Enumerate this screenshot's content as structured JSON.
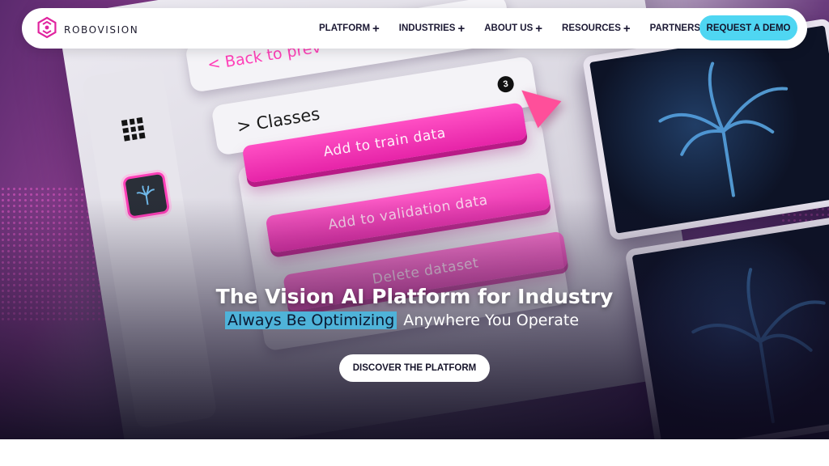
{
  "brand": {
    "name": "ROBOVISION",
    "logo_icon": "robovision-hexagon-logo",
    "accent": "#e0249f"
  },
  "nav": {
    "items": [
      {
        "label": "PLATFORM",
        "has_plus": true
      },
      {
        "label": "INDUSTRIES",
        "has_plus": true
      },
      {
        "label": "ABOUT US",
        "has_plus": true
      },
      {
        "label": "RESOURCES",
        "has_plus": true
      },
      {
        "label": "PARTNERS",
        "has_plus": false
      }
    ],
    "plus_glyph": "+",
    "cta_label": "REQUEST A DEMO",
    "cta_color": "#4fd6f2"
  },
  "hero": {
    "headline": "The Vision AI Platform for Industry",
    "subline_highlight": "Always Be Optimizing",
    "subline_rest": "Anywhere You Operate",
    "highlight_color": "#4fb3d9",
    "cta_label": "DISCOVER THE PLATFORM"
  },
  "mockup": {
    "back_label": "< Back to prev",
    "classes_label": "> Classes",
    "classes_count": "3",
    "actions": [
      "Add to train data",
      "Add to validation data",
      "Delete dataset"
    ],
    "button_color": "#ff3fb8",
    "icons": [
      "grid-icon",
      "plant-thumbnail-icon",
      "cursor-arrow-icon"
    ]
  }
}
